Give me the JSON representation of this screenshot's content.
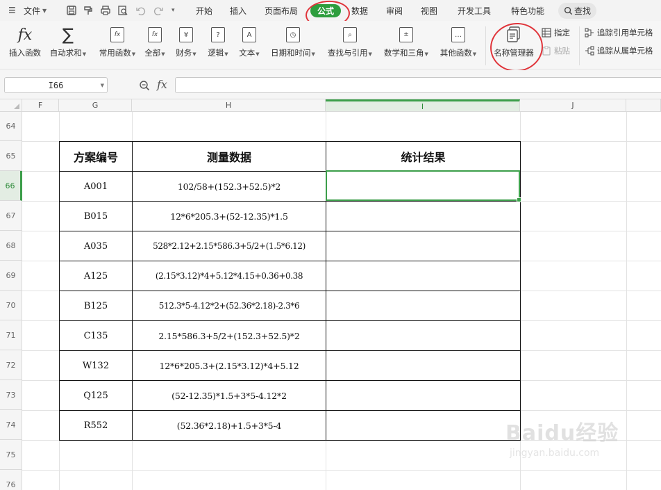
{
  "menu": {
    "file_label": "文件",
    "tabs": [
      "开始",
      "插入",
      "页面布局",
      "公式",
      "数据",
      "审阅",
      "视图",
      "开发工具",
      "特色功能"
    ],
    "active_tab": "公式",
    "search_label": "查找"
  },
  "ribbon": {
    "insert_function": "插入函数",
    "autosum": "自动求和",
    "common_functions": "常用函数",
    "all": "全部",
    "financial": "财务",
    "logical": "逻辑",
    "text": "文本",
    "datetime": "日期和时间",
    "lookup": "查找与引用",
    "math": "数学和三角",
    "other": "其他函数",
    "name_manager": "名称管理器",
    "specify": "指定",
    "paste": "粘贴",
    "trace_precedents": "追踪引用单元格",
    "trace_dependents": "追踪从属单元格"
  },
  "formula_bar": {
    "cell_ref": "I66",
    "fx_label": "fx",
    "content": ""
  },
  "columns": [
    "F",
    "G",
    "H",
    "I",
    "J"
  ],
  "selected_column": "I",
  "rows": [
    "64",
    "65",
    "66",
    "67",
    "68",
    "69",
    "70",
    "71",
    "72",
    "73",
    "74",
    "75",
    "76"
  ],
  "selected_row": "66",
  "table": {
    "headers": [
      "方案编号",
      "测量数据",
      "统计结果"
    ],
    "rows": [
      {
        "id": "A001",
        "formula": "102/58+(152.3+52.5)*2",
        "result": ""
      },
      {
        "id": "B015",
        "formula": "12*6*205.3+(52-12.35)*1.5",
        "result": ""
      },
      {
        "id": "A035",
        "formula": "528*2.12+2.15*586.3+5/2+(1.5*6.12)",
        "result": ""
      },
      {
        "id": "A125",
        "formula": "(2.15*3.12)*4+5.12*4.15+0.36+0.38",
        "result": ""
      },
      {
        "id": "B125",
        "formula": "512.3*5-4.12*2+(52.36*2.18)-2.3*6",
        "result": ""
      },
      {
        "id": "C135",
        "formula": "2.15*586.3+5/2+(152.3+52.5)*2",
        "result": ""
      },
      {
        "id": "W132",
        "formula": "12*6*205.3+(2.15*3.12)*4+5.12",
        "result": ""
      },
      {
        "id": "Q125",
        "formula": "(52-12.35)*1.5+3*5-4.12*2",
        "result": ""
      },
      {
        "id": "R552",
        "formula": "(52.36*2.18)+1.5+3*5-4",
        "result": ""
      }
    ]
  },
  "watermark": {
    "brand": "Baidu经验",
    "site": "jingyan.baidu.com"
  },
  "colors": {
    "accent": "#2e9e3e",
    "annotation": "#e0343a",
    "selection": "#3c9e4a"
  }
}
